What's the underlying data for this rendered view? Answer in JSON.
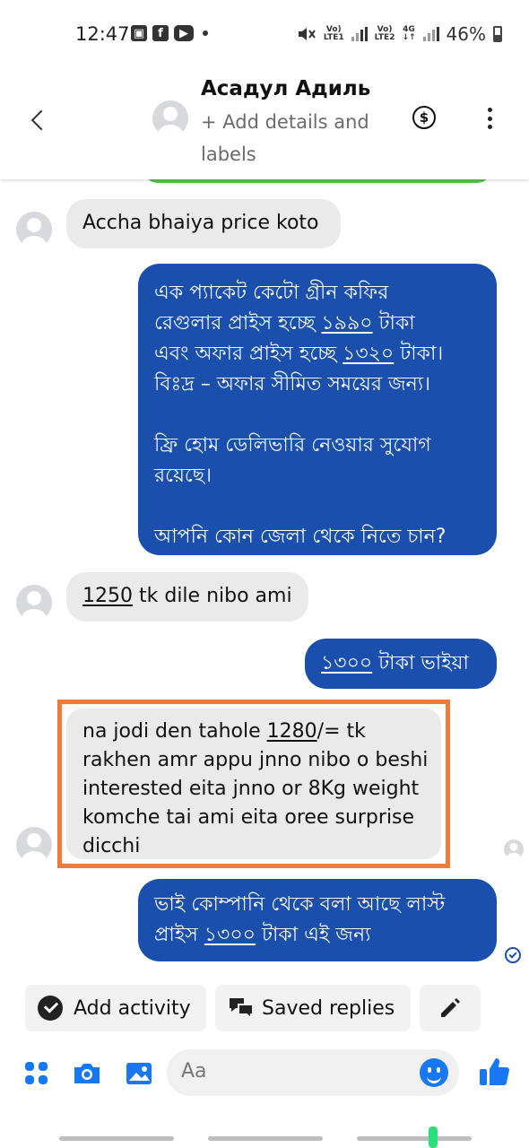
{
  "status_bar": {
    "time": "12:47",
    "battery": "46%",
    "sim1": [
      "Vo)",
      "LTE1"
    ],
    "sim2": [
      "Vo)",
      "LTE2"
    ],
    "net": "4G",
    "icons": [
      "gallery-icon",
      "facebook-icon",
      "youtube-icon",
      "mute-icon"
    ]
  },
  "header": {
    "name": "Асадул Адиль",
    "subtitle": "+ Add details and labels"
  },
  "messages": [
    {
      "direction": "in",
      "text": "Accha bhaiya price koto"
    },
    {
      "direction": "out",
      "lines": [
        "এক প্যাকেট কেটো গ্রীন কফির",
        "রেগুলার প্রাইস হচ্ছে",
        "১৯৯০",
        "টাকা",
        "এবং অফার প্রাইস হচ্ছে",
        "১৩২০",
        "টাকা।",
        "বিঃদ্র – অফার সীমিত সময়ের জন্য।",
        "ফ্রি হোম ডেলিভারি নেওয়ার সুযোগ",
        "রয়েছে।",
        "আপনি কোন জেলা থেকে নিতে চান?"
      ]
    },
    {
      "direction": "in",
      "num": "1250",
      "rest": " tk dile nibo ami"
    },
    {
      "direction": "out",
      "num": "১৩০০",
      "rest": " টাকা ভাইয়া"
    },
    {
      "direction": "in",
      "highlighted": true,
      "line1_pre": "na jodi den tahole ",
      "line1_num": "1280",
      "line1_post": "/= tk",
      "line2": "rakhen amr appu jnno nibo o beshi",
      "line3": "interested eita jnno or 8Kg weight",
      "line4": "komche tai ami eita oree surprise",
      "line5": "dicchi"
    },
    {
      "direction": "out",
      "line1": "ভাই কোম্পানি থেকে বলা আছে লাস্ট",
      "line2_pre": "প্রাইস ",
      "line2_num": "১৩০০",
      "line2_post": " টাকা এই জন্য"
    }
  ],
  "quick_actions": {
    "add_activity": "Add activity",
    "saved_replies": "Saved replies"
  },
  "composer": {
    "placeholder": "Aa"
  },
  "colors": {
    "outgoing_bubble": "#1a4fad",
    "incoming_bubble": "#eaeaea",
    "highlight_border": "#f07a3a",
    "messenger_blue": "#1877f2"
  }
}
